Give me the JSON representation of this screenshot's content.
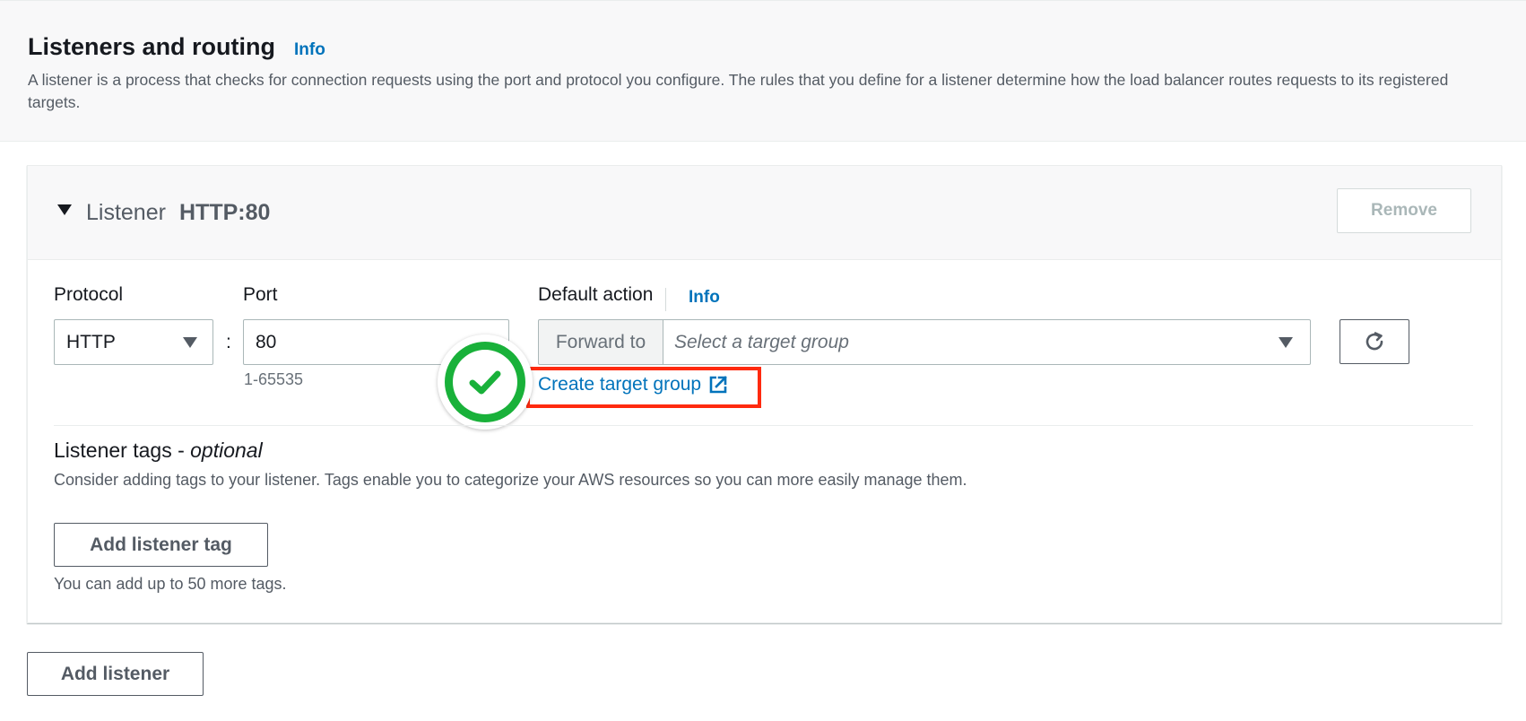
{
  "header": {
    "title": "Listeners and routing",
    "info": "Info",
    "description": "A listener is a process that checks for connection requests using the port and protocol you configure. The rules that you define for a listener determine how the load balancer routes requests to its registered targets."
  },
  "listener": {
    "title_prefix": "Listener",
    "title_value": "HTTP:80",
    "remove_label": "Remove",
    "protocol": {
      "label": "Protocol",
      "value": "HTTP"
    },
    "port": {
      "label": "Port",
      "value": "80",
      "hint": "1-65535",
      "separator": ":"
    },
    "default_action": {
      "label": "Default action",
      "info": "Info",
      "addon": "Forward to",
      "placeholder": "Select a target group",
      "create_link": "Create target group"
    },
    "tags": {
      "title": "Listener tags - ",
      "title_optional": "optional",
      "description": "Consider adding tags to your listener. Tags enable you to categorize your AWS resources so you can more easily manage them.",
      "add_label": "Add listener tag",
      "note": "You can add up to 50 more tags."
    }
  },
  "footer": {
    "add_listener_label": "Add listener"
  },
  "colors": {
    "link": "#0073bb",
    "highlight": "#ff2a0f",
    "success": "#19b13a"
  },
  "icons": [
    "caret-down-icon",
    "dropdown-arrow-icon",
    "refresh-icon",
    "external-link-icon",
    "checkmark-icon"
  ]
}
